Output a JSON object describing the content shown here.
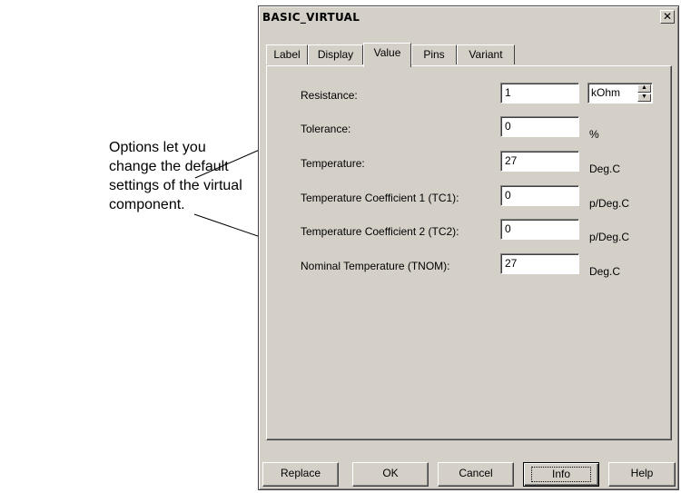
{
  "callout": {
    "lines": [
      "Options let you",
      "change the default",
      "settings of the virtual",
      "component."
    ]
  },
  "dialog": {
    "title": "BASIC_VIRTUAL",
    "close_glyph": "✕",
    "tabs": [
      {
        "label": "Label",
        "active": false
      },
      {
        "label": "Display",
        "active": false
      },
      {
        "label": "Value",
        "active": true
      },
      {
        "label": "Pins",
        "active": false
      },
      {
        "label": "Variant",
        "active": false
      }
    ],
    "rows": [
      {
        "label": "Resistance:",
        "value": "1",
        "unit": "kOhm"
      },
      {
        "label": "Tolerance:",
        "value": "0",
        "unit": "%"
      },
      {
        "label": "Temperature:",
        "value": "27",
        "unit": "Deg.C"
      },
      {
        "label": "Temperature Coefficient 1 (TC1):",
        "value": "0",
        "unit": "p/Deg.C"
      },
      {
        "label": "Temperature Coefficient 2 (TC2):",
        "value": "0",
        "unit": "p/Deg.C"
      },
      {
        "label": "Nominal Temperature (TNOM):",
        "value": "27",
        "unit": "Deg.C"
      }
    ],
    "buttons": {
      "replace": "Replace",
      "ok": "OK",
      "cancel": "Cancel",
      "info": "Info",
      "help": "Help"
    }
  }
}
